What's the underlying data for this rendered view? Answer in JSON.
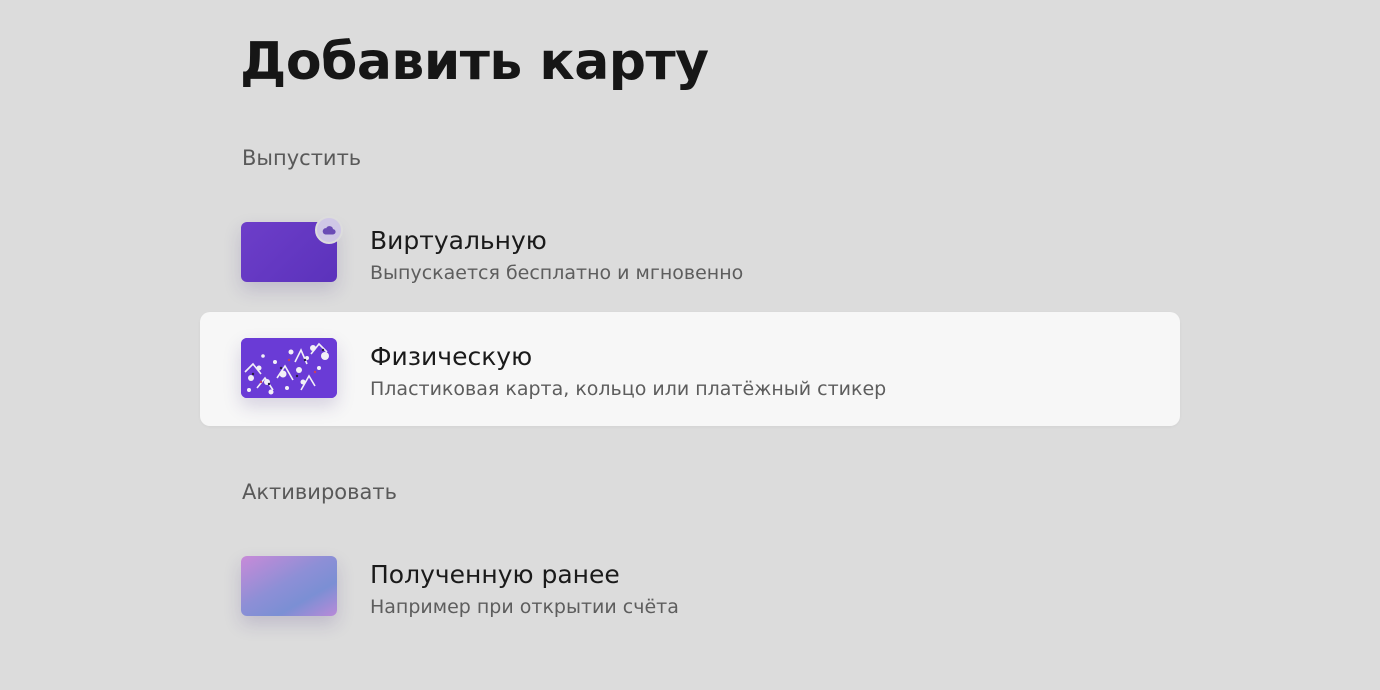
{
  "page_title": "Добавить карту",
  "sections": [
    {
      "label": "Выпустить",
      "options": [
        {
          "title": "Виртуальную",
          "subtitle": "Выпускается бесплатно и мгновенно",
          "icon": "virtual-card-icon",
          "badge_icon": "cloud-icon"
        },
        {
          "title": "Физическую",
          "subtitle": "Пластиковая карта, кольцо или платёжный стикер",
          "icon": "physical-card-icon",
          "highlighted": true
        }
      ]
    },
    {
      "label": "Активировать",
      "options": [
        {
          "title": "Полученную ранее",
          "subtitle": "Например при открытии счёта",
          "icon": "received-card-icon"
        }
      ]
    }
  ],
  "colors": {
    "background": "#dcdcdc",
    "highlight": "#f7f7f7",
    "virtual_card": "#6239c4",
    "physical_card": "#6a3bd6",
    "badge": "#cfc7e6",
    "badge_glyph": "#6a4bb5"
  }
}
